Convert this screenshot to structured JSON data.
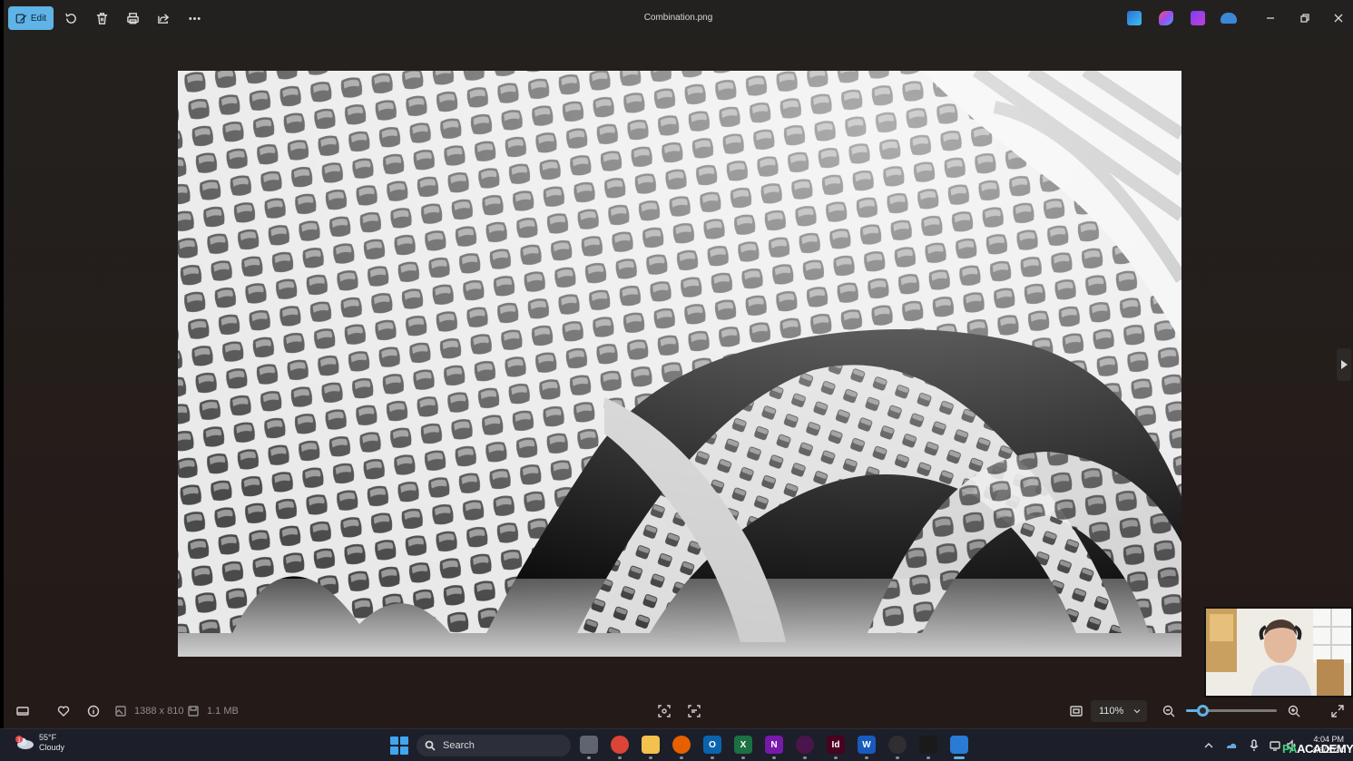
{
  "window": {
    "filename": "Combination.png",
    "edit_label": "Edit"
  },
  "toolbar": {
    "icons": [
      "edit-icon",
      "rotate-icon",
      "delete-icon",
      "print-icon",
      "share-icon",
      "more-icon"
    ],
    "app_icons": [
      "designer-icon",
      "copilot-icon",
      "clipchamp-icon",
      "onedrive-icon"
    ],
    "window_controls": [
      "minimize-icon",
      "restore-icon",
      "close-icon"
    ]
  },
  "image": {
    "description_icon": "architectural-lattice-render"
  },
  "info_bar": {
    "dimensions": "1388 x 810",
    "file_size": "1.1 MB",
    "zoom": "110%",
    "zoom_fraction": 0.18
  },
  "taskbar": {
    "weather": {
      "temp": "55°F",
      "condition": "Cloudy",
      "badge": "1"
    },
    "search_label": "Search",
    "apps": [
      {
        "name": "task-view",
        "color": "#5f6470",
        "glyph": ""
      },
      {
        "name": "chrome",
        "color": "#db4437",
        "glyph": ""
      },
      {
        "name": "file-explorer",
        "color": "#f2c14e",
        "glyph": ""
      },
      {
        "name": "firefox",
        "color": "#e66000",
        "glyph": ""
      },
      {
        "name": "outlook",
        "color": "#0a64ad",
        "glyph": "O"
      },
      {
        "name": "excel",
        "color": "#1d7044",
        "glyph": "X"
      },
      {
        "name": "onenote",
        "color": "#7719aa",
        "glyph": "N"
      },
      {
        "name": "slack",
        "color": "#4a154b",
        "glyph": ""
      },
      {
        "name": "indesign",
        "color": "#49021f",
        "glyph": "Id"
      },
      {
        "name": "word",
        "color": "#185abd",
        "glyph": "W"
      },
      {
        "name": "obs",
        "color": "#302e31",
        "glyph": ""
      },
      {
        "name": "rhino",
        "color": "#1a1a1a",
        "glyph": ""
      },
      {
        "name": "photos",
        "color": "#2a7bd4",
        "glyph": ""
      }
    ],
    "clock_time": "4:04 PM",
    "clock_date": "4/6/2024"
  },
  "brand": {
    "pa": "PA",
    "academy": "ACADEMY"
  },
  "colors": {
    "accent": "#5fb3e6",
    "bg": "#231d1a",
    "taskbar": "#1c1f29"
  }
}
